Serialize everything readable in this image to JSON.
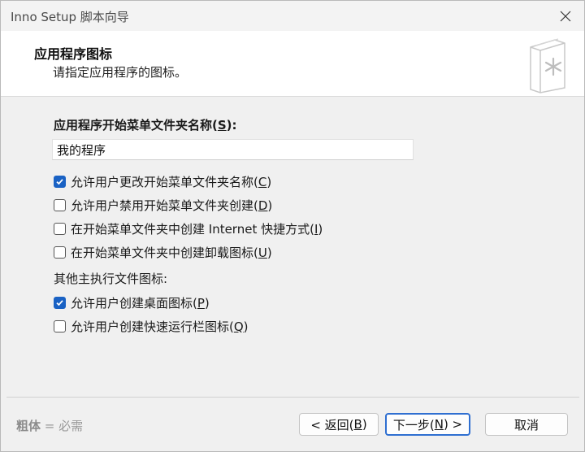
{
  "window": {
    "title": "Inno Setup 脚本向导"
  },
  "header": {
    "title": "应用程序图标",
    "subtitle": "请指定应用程序的图标。"
  },
  "form": {
    "folder_label": "应用程序开始菜单文件夹名称(",
    "folder_label_key": "S",
    "folder_label_end": "):",
    "folder_value": "我的程序",
    "options": [
      {
        "text": "允许用户更改开始菜单文件夹名称(",
        "key": "C",
        "end": ")",
        "checked": true
      },
      {
        "text": "允许用户禁用开始菜单文件夹创建(",
        "key": "D",
        "end": ")",
        "checked": false
      },
      {
        "text": "在开始菜单文件夹中创建 Internet 快捷方式(",
        "key": "I",
        "end": ")",
        "checked": false
      },
      {
        "text": "在开始菜单文件夹中创建卸载图标(",
        "key": "U",
        "end": ")",
        "checked": false
      }
    ],
    "group_label": "其他主执行文件图标:",
    "other_options": [
      {
        "text": "允许用户创建桌面图标(",
        "key": "P",
        "end": ")",
        "checked": true
      },
      {
        "text": "允许用户创建快速运行栏图标(",
        "key": "Q",
        "end": ")",
        "checked": false
      }
    ]
  },
  "footer": {
    "legend_bold": "粗体",
    "legend_rest": " = 必需",
    "back_label": "< 返回(",
    "back_key": "B",
    "back_end": ")",
    "next_label": "下一步(",
    "next_key": "N",
    "next_end": ") >",
    "cancel_label": "取消"
  },
  "icons": {
    "close": "close-icon",
    "header": "document-star-icon",
    "check": "checkmark-icon"
  },
  "colors": {
    "accent": "#1a62c4",
    "default_button_border": "#2f6fd1"
  }
}
